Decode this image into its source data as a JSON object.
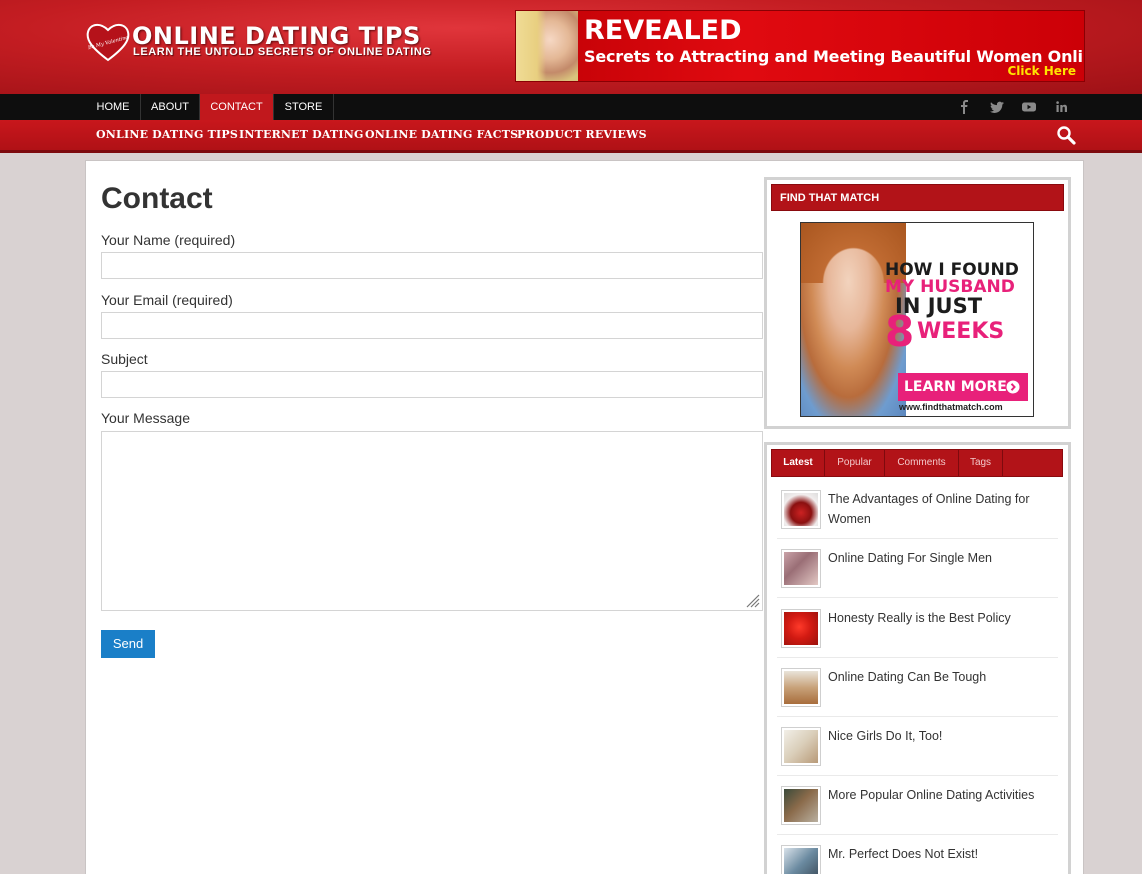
{
  "header": {
    "logo_title": "ONLINE DATING TIPS",
    "logo_subtitle": "LEARN THE UNTOLD SECRETS OF ONLINE DATING",
    "logo_heart_text": "Be My Valentine",
    "banner": {
      "headline": "REVEALED",
      "text": "Secrets to Attracting and Meeting Beautiful Women Online",
      "cta": "Click Here"
    }
  },
  "top_nav": {
    "items": [
      {
        "label": "HOME"
      },
      {
        "label": "ABOUT"
      },
      {
        "label": "CONTACT",
        "active": true
      },
      {
        "label": "STORE"
      }
    ],
    "social": [
      "f",
      "t",
      "yt",
      "in"
    ]
  },
  "main_nav": {
    "items": [
      {
        "label": "ONLINE DATING TIPS"
      },
      {
        "label": "INTERNET DATING"
      },
      {
        "label": "ONLINE DATING FACTS"
      },
      {
        "label": "PRODUCT REVIEWS"
      }
    ]
  },
  "page": {
    "title": "Contact",
    "fields": {
      "name_label": "Your Name (required)",
      "email_label": "Your Email (required)",
      "subject_label": "Subject",
      "message_label": "Your Message"
    },
    "send_label": "Send"
  },
  "sidebar": {
    "widget_title": "FIND THAT MATCH",
    "ad": {
      "line1": "HOW I FOUND",
      "line2": "MY HUSBAND",
      "line3": "IN JUST",
      "line4_num": "8",
      "line4_word": "WEEKS",
      "button": "LEARN MORE",
      "url": "www.findthatmatch.com"
    },
    "tabs": [
      {
        "label": "Latest",
        "active": true
      },
      {
        "label": "Popular"
      },
      {
        "label": "Comments"
      },
      {
        "label": "Tags"
      }
    ],
    "posts": [
      {
        "title": "The Advantages of Online Dating for Women"
      },
      {
        "title": "Online Dating For Single Men"
      },
      {
        "title": "Honesty Really is the Best Policy"
      },
      {
        "title": "Online Dating Can Be Tough"
      },
      {
        "title": "Nice Girls Do It, Too!"
      },
      {
        "title": "More Popular Online Dating Activities"
      },
      {
        "title": "Mr. Perfect Does Not Exist!"
      }
    ]
  },
  "colors": {
    "brand_red": "#c1181d",
    "nav_black": "#0e0e0e",
    "send_blue": "#1a7fc8"
  }
}
